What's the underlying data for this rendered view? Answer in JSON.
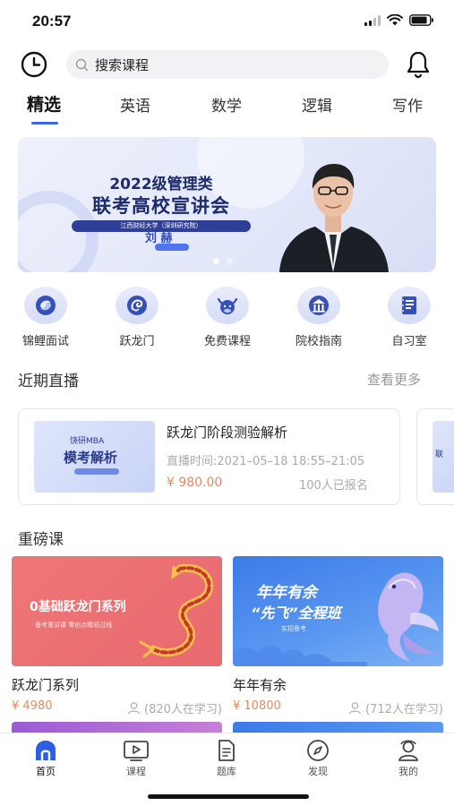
{
  "status_bar": {
    "time": "20:57"
  },
  "header": {
    "search_placeholder": "搜索课程"
  },
  "tabs": [
    {
      "label": "精选",
      "active": true
    },
    {
      "label": "英语"
    },
    {
      "label": "数学"
    },
    {
      "label": "逻辑"
    },
    {
      "label": "写作"
    }
  ],
  "banner": {
    "title_line1": "2022级管理类",
    "title_line2": "联考高校宣讲会",
    "subtitle": "江西财经大学（深圳研究院）",
    "speaker": "刘 赫",
    "page_count": 2,
    "current_page": 1
  },
  "quick_entries": [
    {
      "label": "锦鲤面试",
      "icon": "koi-icon"
    },
    {
      "label": "跃龙门",
      "icon": "dragon-icon"
    },
    {
      "label": "免费课程",
      "icon": "ox-icon"
    },
    {
      "label": "院校指南",
      "icon": "school-icon"
    },
    {
      "label": "自习室",
      "icon": "notebook-icon"
    }
  ],
  "live_section": {
    "title": "近期直播",
    "more": "查看更多",
    "items": [
      {
        "thumb_line1": "饶研MBA",
        "thumb_line2": "模考解析",
        "title": "跃龙门阶段测验解析",
        "time": "直播时间:2021–05–18 18:55–21:05",
        "price": "¥ 980.00",
        "enrolled": "100人已报名"
      },
      {
        "thumb_line1": "联"
      }
    ]
  },
  "course_section": {
    "title": "重磅课",
    "items": [
      {
        "image_title": "0基础跃龙门系列",
        "image_tag": "备考重讲课  零创点睛轻过线",
        "name": "跃龙门系列",
        "price": "¥ 4980",
        "learners": "(820人在学习)"
      },
      {
        "image_title": "年年有余",
        "image_title2": "“先飞”全程班",
        "image_tag": "实招备考",
        "name": "年年有余",
        "price": "¥ 10800",
        "learners": "(712人在学习)"
      }
    ]
  },
  "tabbar": [
    {
      "label": "首页",
      "icon": "home-icon",
      "active": true
    },
    {
      "label": "课程",
      "icon": "play-icon"
    },
    {
      "label": "题库",
      "icon": "document-icon"
    },
    {
      "label": "发现",
      "icon": "compass-icon"
    },
    {
      "label": "我的",
      "icon": "profile-icon"
    }
  ],
  "colors": {
    "accent": "#3a66e8",
    "price": "#e78a5c",
    "muted": "#999999"
  }
}
